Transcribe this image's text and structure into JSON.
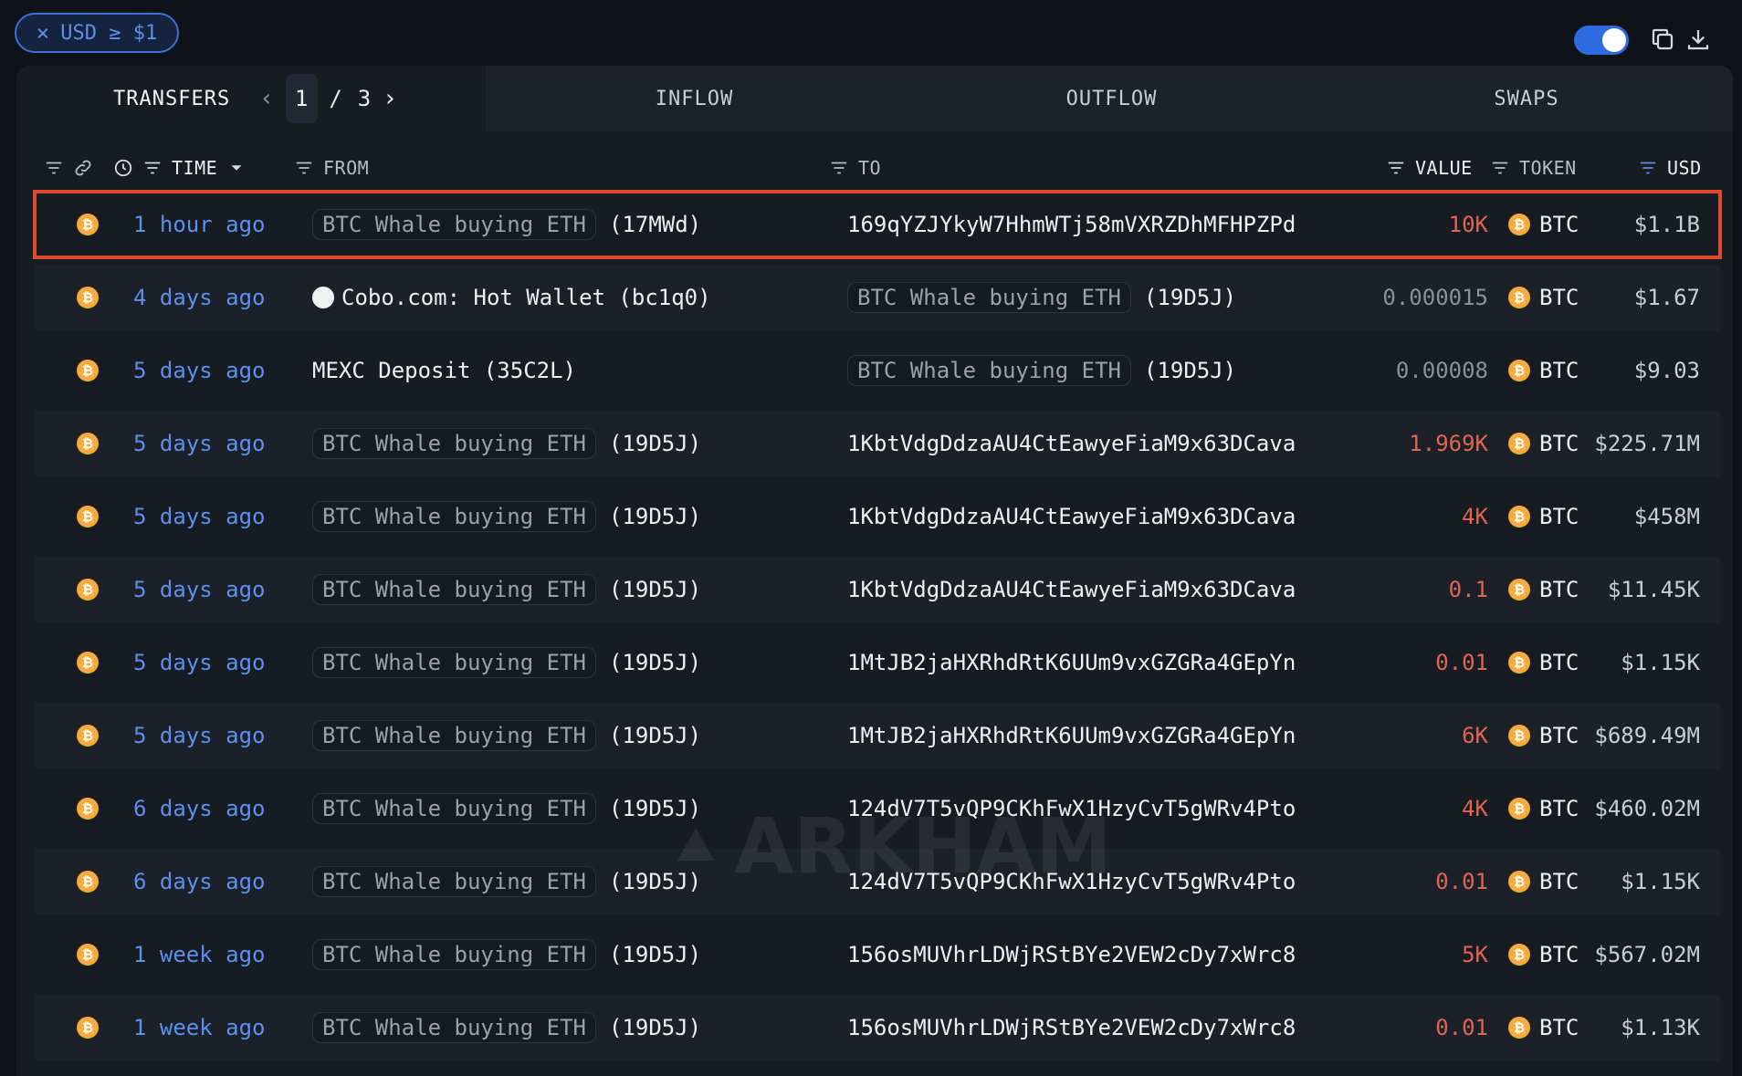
{
  "filter_chip": {
    "close": "×",
    "label": "USD ≥ $1"
  },
  "tabs": {
    "transfers": "TRANSFERS",
    "page_current": "1",
    "page_sep": "/",
    "page_total": "3",
    "inflow": "INFLOW",
    "outflow": "OUTFLOW",
    "swaps": "SWAPS"
  },
  "columns": {
    "time": "TIME",
    "from": "FROM",
    "to": "TO",
    "value": "VALUE",
    "token": "TOKEN",
    "usd": "USD"
  },
  "watermark": "ARKHAM",
  "rows": [
    {
      "time": "1 hour ago",
      "from_label": "BTC Whale buying ETH",
      "from_suffix": "(17MWd)",
      "to_addr": "169qYZJYkyW7HhmWTj58mVXRZDhMFHPZPd",
      "value": "10K",
      "token": "BTC",
      "usd": "$1.1B"
    },
    {
      "time": "4 days ago",
      "from_plain": "Cobo.com: Hot Wallet (bc1q0)",
      "to_label": "BTC Whale buying ETH",
      "to_suffix": "(19D5J)",
      "value": "0.000015",
      "token": "BTC",
      "usd": "$1.67"
    },
    {
      "time": "5 days ago",
      "from_plain": "MEXC Deposit (35C2L)",
      "to_label": "BTC Whale buying ETH",
      "to_suffix": "(19D5J)",
      "value": "0.00008",
      "token": "BTC",
      "usd": "$9.03"
    },
    {
      "time": "5 days ago",
      "from_label": "BTC Whale buying ETH",
      "from_suffix": "(19D5J)",
      "to_addr": "1KbtVdgDdzaAU4CtEawyeFiaM9x63DCava",
      "value": "1.969K",
      "token": "BTC",
      "usd": "$225.71M"
    },
    {
      "time": "5 days ago",
      "from_label": "BTC Whale buying ETH",
      "from_suffix": "(19D5J)",
      "to_addr": "1KbtVdgDdzaAU4CtEawyeFiaM9x63DCava",
      "value": "4K",
      "token": "BTC",
      "usd": "$458M"
    },
    {
      "time": "5 days ago",
      "from_label": "BTC Whale buying ETH",
      "from_suffix": "(19D5J)",
      "to_addr": "1KbtVdgDdzaAU4CtEawyeFiaM9x63DCava",
      "value": "0.1",
      "token": "BTC",
      "usd": "$11.45K"
    },
    {
      "time": "5 days ago",
      "from_label": "BTC Whale buying ETH",
      "from_suffix": "(19D5J)",
      "to_addr": "1MtJB2jaHXRhdRtK6UUm9vxGZGRa4GEpYn",
      "value": "0.01",
      "token": "BTC",
      "usd": "$1.15K"
    },
    {
      "time": "5 days ago",
      "from_label": "BTC Whale buying ETH",
      "from_suffix": "(19D5J)",
      "to_addr": "1MtJB2jaHXRhdRtK6UUm9vxGZGRa4GEpYn",
      "value": "6K",
      "token": "BTC",
      "usd": "$689.49M"
    },
    {
      "time": "6 days ago",
      "from_label": "BTC Whale buying ETH",
      "from_suffix": "(19D5J)",
      "to_addr": "124dV7T5vQP9CKhFwX1HzyCvT5gWRv4Pto",
      "value": "4K",
      "token": "BTC",
      "usd": "$460.02M"
    },
    {
      "time": "6 days ago",
      "from_label": "BTC Whale buying ETH",
      "from_suffix": "(19D5J)",
      "to_addr": "124dV7T5vQP9CKhFwX1HzyCvT5gWRv4Pto",
      "value": "0.01",
      "token": "BTC",
      "usd": "$1.15K"
    },
    {
      "time": "1 week ago",
      "from_label": "BTC Whale buying ETH",
      "from_suffix": "(19D5J)",
      "to_addr": "156osMUVhrLDWjRStBYe2VEW2cDy7xWrc8",
      "value": "5K",
      "token": "BTC",
      "usd": "$567.02M"
    },
    {
      "time": "1 week ago",
      "from_label": "BTC Whale buying ETH",
      "from_suffix": "(19D5J)",
      "to_addr": "156osMUVhrLDWjRStBYe2VEW2cDy7xWrc8",
      "value": "0.01",
      "token": "BTC",
      "usd": "$1.13K"
    }
  ]
}
